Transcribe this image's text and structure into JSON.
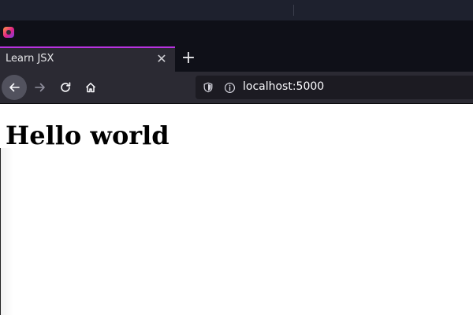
{
  "browser": {
    "tab": {
      "title": "Learn JSX",
      "close_glyph": "✕"
    },
    "new_tab_glyph": "+",
    "toolbar": {
      "back_icon": "arrow-left-icon",
      "forward_icon": "arrow-right-icon",
      "reload_icon": "reload-icon",
      "home_icon": "home-icon"
    },
    "urlbar": {
      "url": "localhost:5000",
      "shield_icon": "shield-icon",
      "info_icon": "info-icon"
    },
    "colors": {
      "tab_accent": "#b833e1",
      "chrome_bg": "#2b2a33",
      "urlbar_bg": "#1c1b22"
    }
  },
  "page": {
    "heading": "Hello world"
  }
}
